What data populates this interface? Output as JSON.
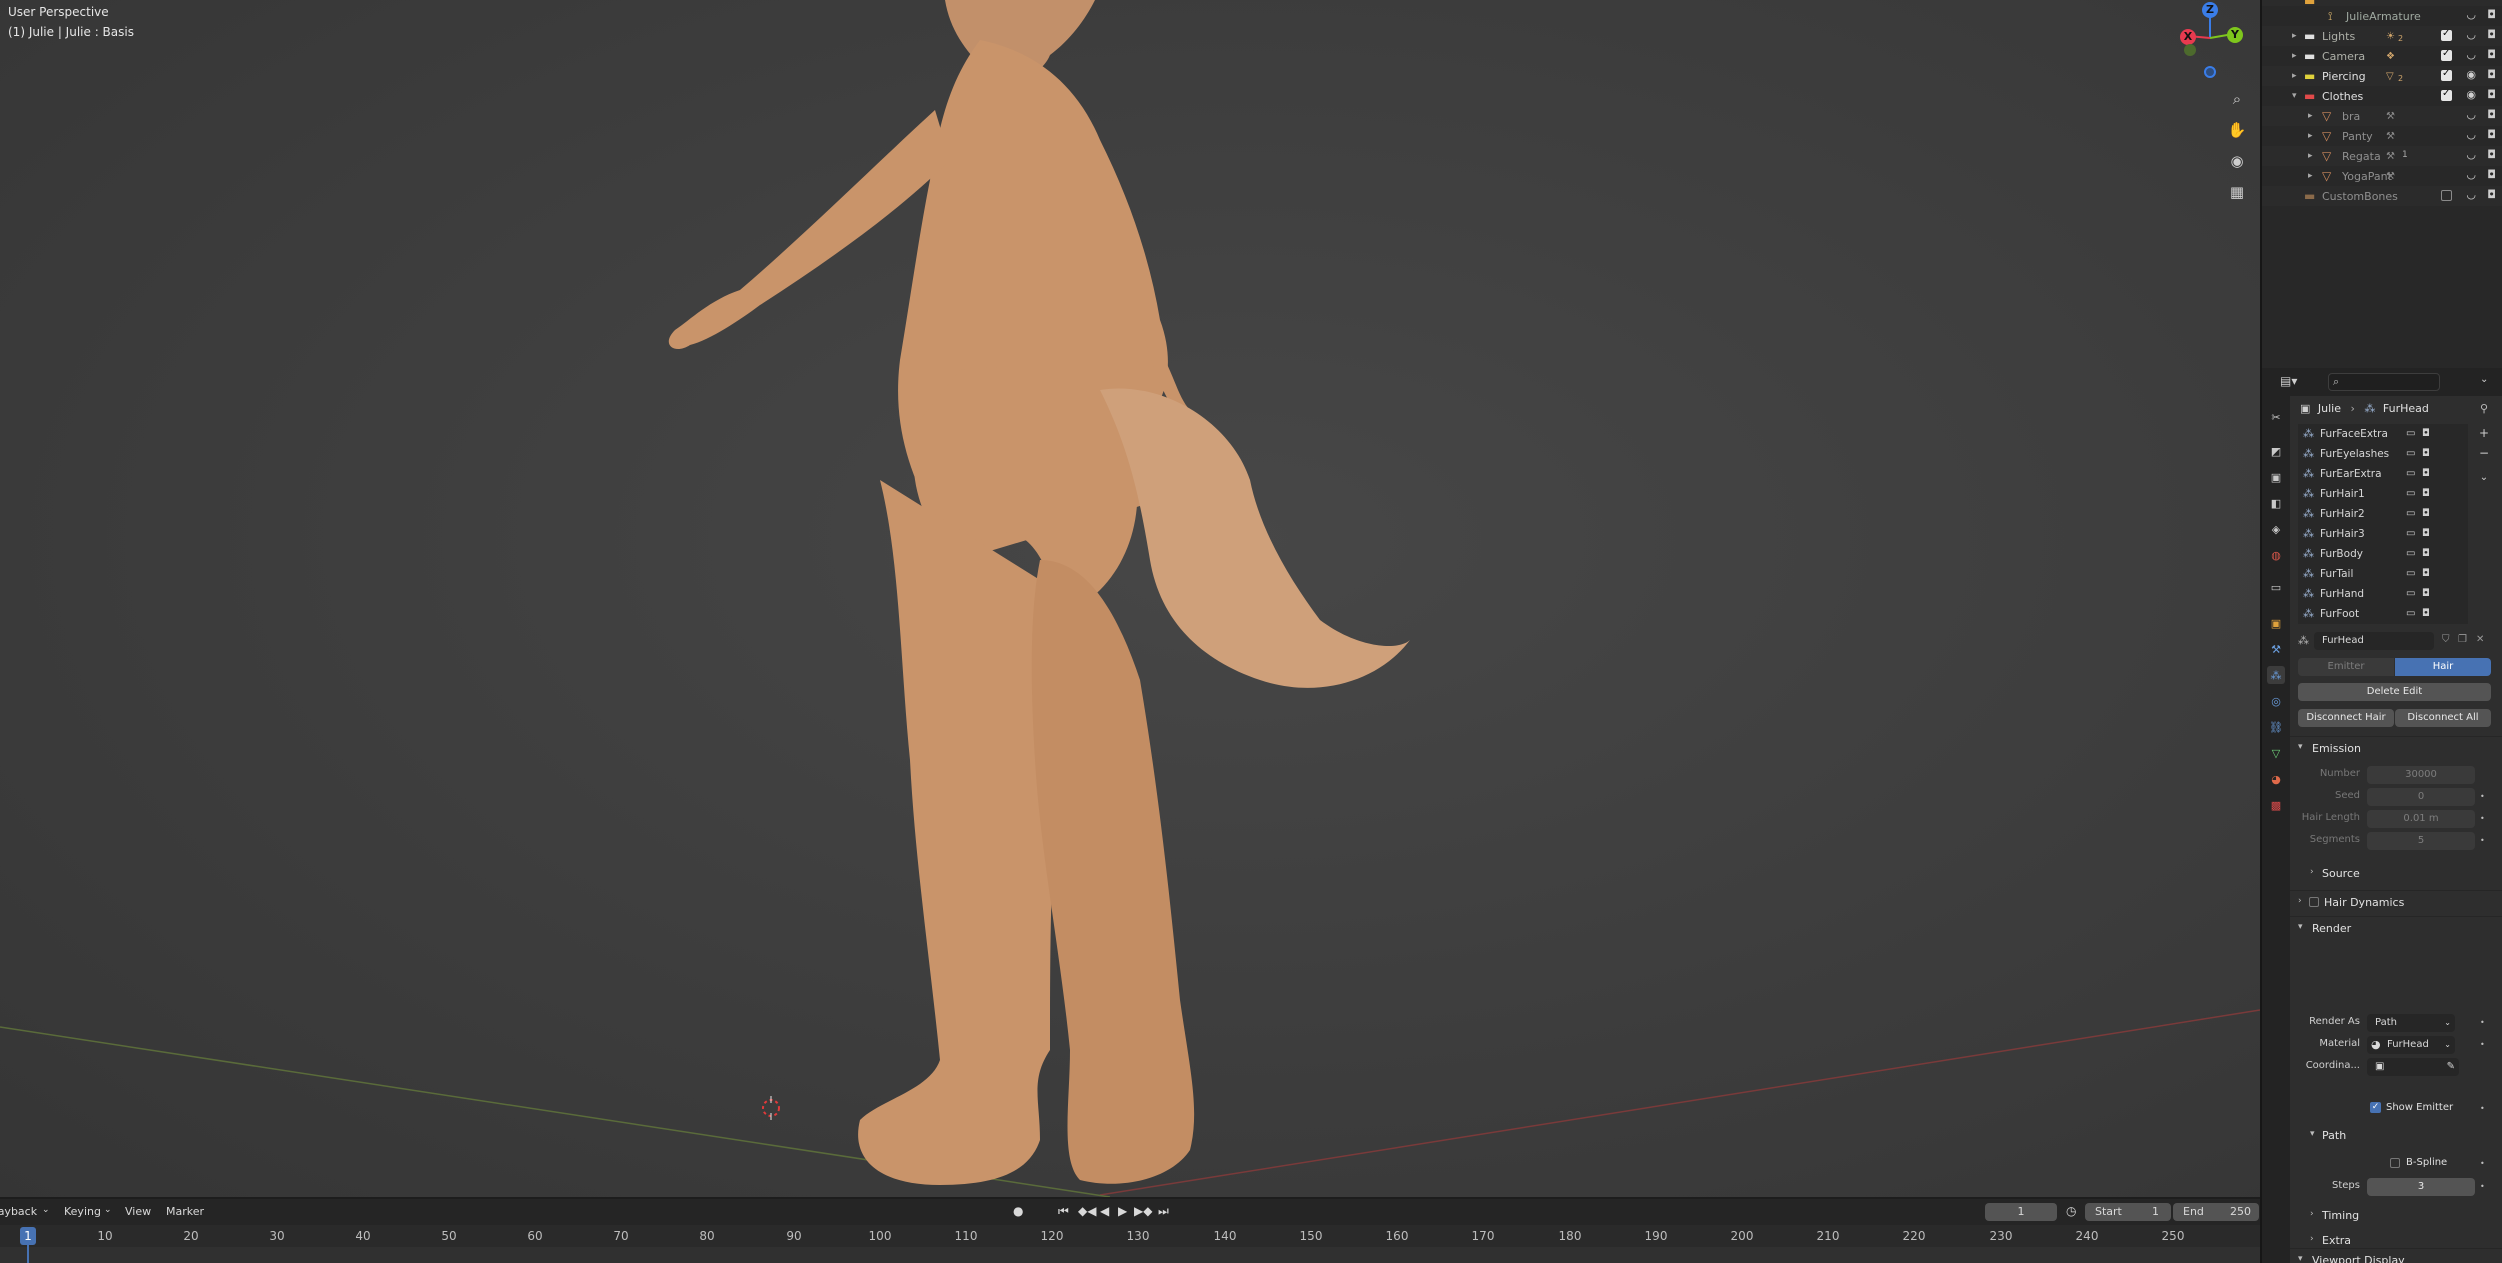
{
  "viewport": {
    "mode_label": "User Perspective",
    "object_label": "(1) Julie | Julie : Basis",
    "gizmo": {
      "x": "X",
      "y": "Y",
      "z": "Z"
    }
  },
  "outliner": {
    "rows": [
      {
        "label": "JulieArmature",
        "icon": "armature-icon",
        "depth": 3,
        "expander": ""
      },
      {
        "label": "Lights",
        "icon": "collection-icon",
        "depth": 1,
        "expander": "▸",
        "badge": "2"
      },
      {
        "label": "Camera",
        "icon": "collection-icon",
        "depth": 1,
        "expander": "▸",
        "badge": ""
      },
      {
        "label": "Piercing",
        "icon": "collection-icon",
        "depth": 1,
        "expander": "▸",
        "badge": "2"
      },
      {
        "label": "Clothes",
        "icon": "collection-icon",
        "depth": 1,
        "expander": "▾",
        "badge": ""
      },
      {
        "label": "bra",
        "icon": "mesh-icon",
        "depth": 2,
        "expander": "▸",
        "badge": ""
      },
      {
        "label": "Panty",
        "icon": "mesh-icon",
        "depth": 2,
        "expander": "▸",
        "badge": ""
      },
      {
        "label": "Regata",
        "icon": "mesh-icon",
        "depth": 2,
        "expander": "▸",
        "badge": "1"
      },
      {
        "label": "YogaPant",
        "icon": "mesh-icon",
        "depth": 2,
        "expander": "▸",
        "badge": ""
      },
      {
        "label": "CustomBones",
        "icon": "collection-icon",
        "depth": 1,
        "expander": "",
        "badge": ""
      }
    ]
  },
  "properties": {
    "breadcrumb": {
      "object": "Julie",
      "psys": "FurHead"
    },
    "particle_systems": [
      "FurFaceExtra",
      "FurEyelashes",
      "FurEarExtra",
      "FurHair1",
      "FurHair2",
      "FurHair3",
      "FurBody",
      "FurTail",
      "FurHand",
      "FurFoot"
    ],
    "settings_name": "FurHead",
    "type_tabs": {
      "emitter": "Emitter",
      "hair": "Hair"
    },
    "delete_edit": "Delete Edit",
    "disconnect_hair": "Disconnect Hair",
    "disconnect_all": "Disconnect All",
    "emission": {
      "title": "Emission",
      "number_label": "Number",
      "number": "30000",
      "seed_label": "Seed",
      "seed": "0",
      "hair_length_label": "Hair Length",
      "hair_length": "0.01 m",
      "segments_label": "Segments",
      "segments": "5"
    },
    "source_title": "Source",
    "hair_dynamics_title": "Hair Dynamics",
    "render": {
      "title": "Render",
      "render_as_label": "Render As",
      "render_as": "Path",
      "material_label": "Material",
      "material": "FurHead",
      "coordinate_label": "Coordina...",
      "show_emitter": "Show Emitter"
    },
    "path": {
      "title": "Path",
      "bspline": "B-Spline",
      "steps_label": "Steps",
      "steps": "3"
    },
    "timing_title": "Timing",
    "extra_title": "Extra",
    "viewport_display_title": "Viewport Display"
  },
  "timeline": {
    "menus": [
      "Playback",
      "Keying",
      "View",
      "Marker"
    ],
    "current_frame": "1",
    "start_label": "Start",
    "start": "1",
    "end_label": "End",
    "end": "250",
    "ticks": [
      "1",
      "10",
      "20",
      "30",
      "40",
      "50",
      "60",
      "70",
      "80",
      "90",
      "100",
      "110",
      "120",
      "130",
      "140",
      "150",
      "160",
      "170",
      "180",
      "190",
      "200",
      "210",
      "220",
      "230",
      "240",
      "250"
    ]
  },
  "colors": {
    "accent": "#4772b3",
    "skin": "#c9946a",
    "x_axis": "#e83a4f",
    "y_axis": "#7ec61d",
    "z_axis": "#3a7de8"
  }
}
